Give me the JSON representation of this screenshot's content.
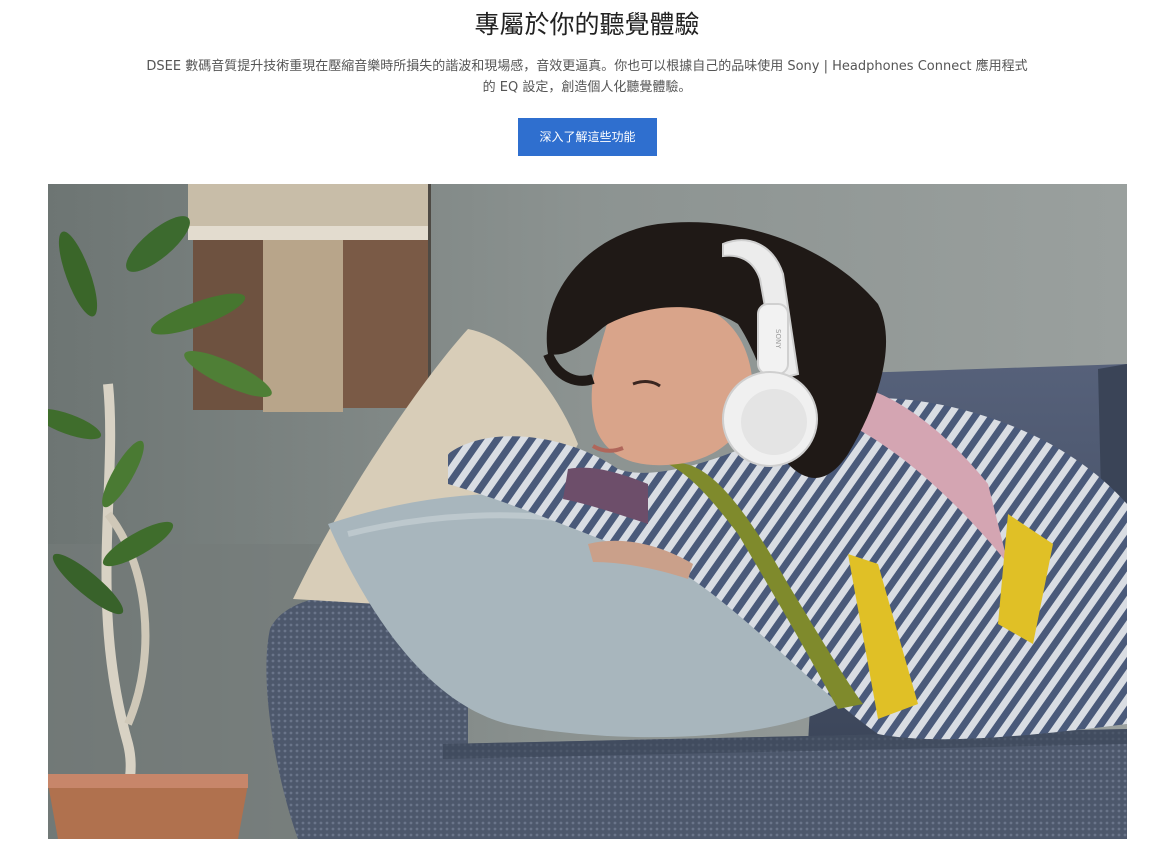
{
  "section": {
    "title": "專屬於你的聽覺體驗",
    "description_line1": "DSEE 數碼音質提升技術重現在壓縮音樂時所損失的諧波和現場感，音效更逼真。你也可以根據自己的品味使用 Sony | Headphones Connect 應用程式",
    "description_line2": "的 EQ 設定，創造個人化聽覺體驗。",
    "cta_label": "深入了解這些功能"
  },
  "hero": {
    "image_subject": "woman-with-white-headphones-on-sofa",
    "headphone_brand_mark": "SONY"
  },
  "colors": {
    "accent": "#2f6fcf",
    "title": "#222222",
    "body_text": "#555555",
    "sofa": "#4a5566",
    "wall": "#7e8583"
  }
}
